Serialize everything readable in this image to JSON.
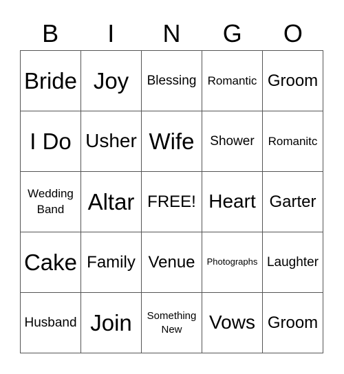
{
  "header": {
    "letters": [
      "B",
      "I",
      "N",
      "G",
      "O"
    ]
  },
  "grid": {
    "rows": [
      [
        "Bride",
        "Joy",
        "Blessing",
        "Romantic",
        "Groom"
      ],
      [
        "I Do",
        "Usher",
        "Wife",
        "Shower",
        "Romanitc"
      ],
      [
        "Wedding Band",
        "Altar",
        "FREE!",
        "Heart",
        "Garter"
      ],
      [
        "Cake",
        "Family",
        "Venue",
        "Photographs",
        "Laughter"
      ],
      [
        "Husband",
        "Join",
        "Something New",
        "Vows",
        "Groom"
      ]
    ]
  }
}
